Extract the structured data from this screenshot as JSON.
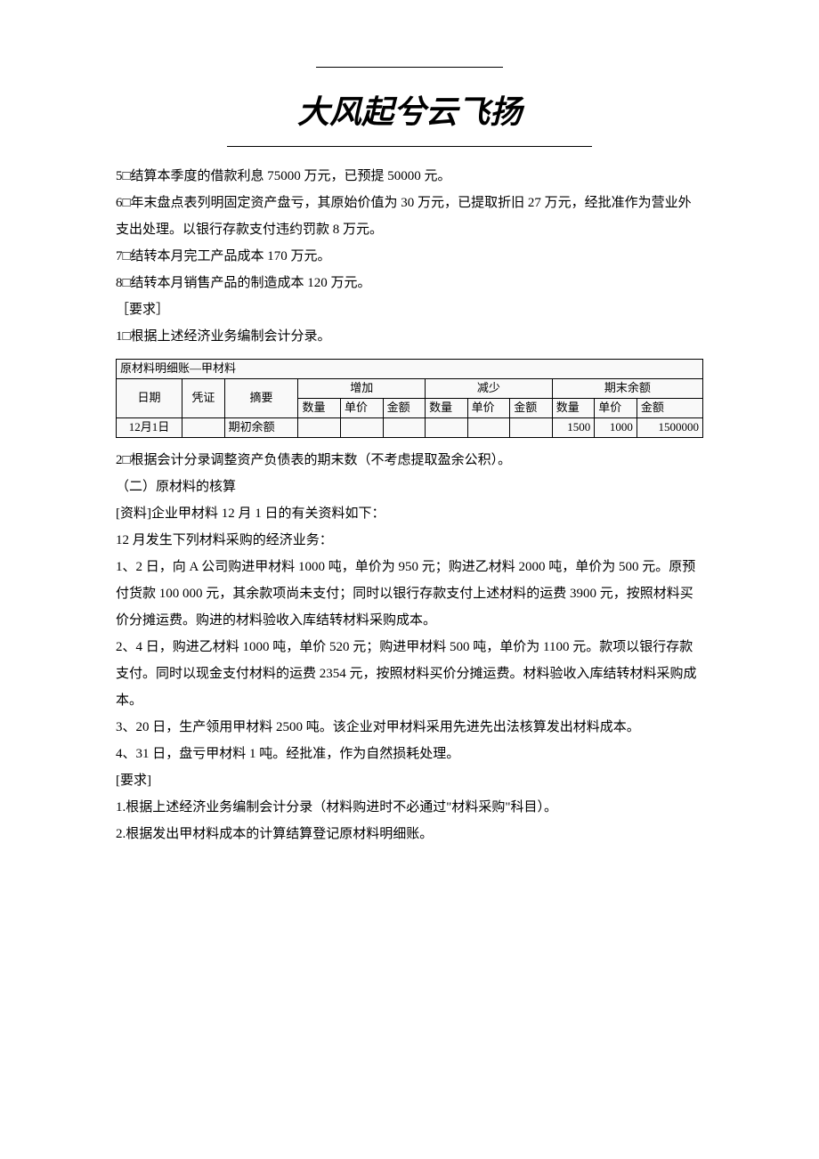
{
  "header": {
    "title": "大风起兮云飞扬"
  },
  "paragraphs_top": [
    "5□结算本季度的借款利息 75000 万元，已预提 50000 元。",
    "6□年末盘点表列明固定资产盘亏，其原始价值为 30 万元，已提取折旧 27 万元，经批准作为营业外支出处理。以银行存款支付违约罚款 8 万元。",
    "7□结转本月完工产品成本 170 万元。",
    "8□结转本月销售产品的制造成本 120 万元。",
    "［要求］",
    "1□根据上述经济业务编制会计分录。"
  ],
  "table": {
    "title": "原材料明细账—甲材料",
    "headers": {
      "date": "日期",
      "voucher": "凭证",
      "summary": "摘要",
      "increase": "增加",
      "decrease": "减少",
      "balance": "期末余额",
      "qty": "数量",
      "price": "单价",
      "amount": "金额"
    },
    "row": {
      "date": "12月1日",
      "voucher": "",
      "summary": "期初余额",
      "inc_qty": "",
      "inc_price": "",
      "inc_amount": "",
      "dec_qty": "",
      "dec_price": "",
      "dec_amount": "",
      "bal_qty": "1500",
      "bal_price": "1000",
      "bal_amount": "1500000"
    }
  },
  "paragraphs_bottom": [
    "2□根据会计分录调整资产负债表的期末数（不考虑提取盈余公积）。",
    "（二）原材料的核算",
    "[资料]企业甲材料 12 月 1 日的有关资料如下：",
    "",
    "12 月发生下列材料采购的经济业务：",
    "1、2 日，向 A 公司购进甲材料 1000 吨，单价为 950 元；购进乙材料 2000 吨，单价为 500 元。原预付货款 100 000 元，其余款项尚未支付；同时以银行存款支付上述材料的运费 3900 元，按照材料买价分摊运费。购进的材料验收入库结转材料采购成本。",
    "2、4 日，购进乙材料 1000 吨，单价 520 元；购进甲材料 500 吨，单价为 1100 元。款项以银行存款支付。同时以现金支付材料的运费 2354 元，按照材料买价分摊运费。材料验收入库结转材料采购成本。",
    "3、20 日，生产领用甲材料 2500 吨。该企业对甲材料采用先进先出法核算发出材料成本。",
    "4、31 日，盘亏甲材料 1 吨。经批准，作为自然损耗处理。",
    "[要求]",
    "1.根据上述经济业务编制会计分录（材料购进时不必通过\"材料采购\"科目）。",
    "2.根据发出甲材料成本的计算结算登记原材料明细账。"
  ]
}
